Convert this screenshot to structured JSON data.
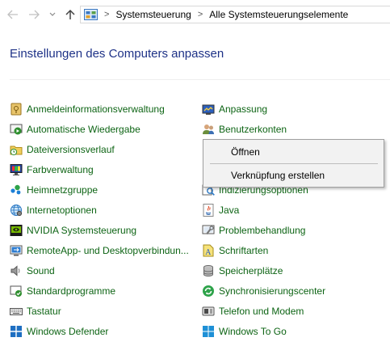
{
  "nav": {
    "breadcrumbs": [
      "Systemsteuerung",
      "Alle Systemsteuerungselemente"
    ]
  },
  "heading": "Einstellungen des Computers anpassen",
  "items_left": [
    {
      "label": "Anmeldeinformationsverwaltung",
      "icon": "credential-manager-icon"
    },
    {
      "label": "Automatische Wiedergabe",
      "icon": "autoplay-icon"
    },
    {
      "label": "Dateiversionsverlauf",
      "icon": "file-history-icon"
    },
    {
      "label": "Farbverwaltung",
      "icon": "color-management-icon"
    },
    {
      "label": "Heimnetzgruppe",
      "icon": "homegroup-icon"
    },
    {
      "label": "Internetoptionen",
      "icon": "internet-options-icon"
    },
    {
      "label": "NVIDIA Systemsteuerung",
      "icon": "nvidia-icon"
    },
    {
      "label": "RemoteApp- und Desktopverbindun...",
      "icon": "remoteapp-icon"
    },
    {
      "label": "Sound",
      "icon": "sound-icon"
    },
    {
      "label": "Standardprogramme",
      "icon": "default-programs-icon"
    },
    {
      "label": "Tastatur",
      "icon": "keyboard-icon"
    },
    {
      "label": "Windows Defender",
      "icon": "windows-defender-icon"
    }
  ],
  "items_right": [
    {
      "label": "Anpassung",
      "icon": "personalization-icon"
    },
    {
      "label": "Benutzerkonten",
      "icon": "user-accounts-icon"
    },
    {
      "label": "",
      "icon": ""
    },
    {
      "label": "",
      "icon": ""
    },
    {
      "label": "Indizierungsoptionen",
      "icon": "indexing-options-icon"
    },
    {
      "label": "Java",
      "icon": "java-icon"
    },
    {
      "label": "Problembehandlung",
      "icon": "troubleshooting-icon"
    },
    {
      "label": "Schriftarten",
      "icon": "fonts-icon"
    },
    {
      "label": "Speicherplätze",
      "icon": "storage-spaces-icon"
    },
    {
      "label": "Synchronisierungscenter",
      "icon": "sync-center-icon"
    },
    {
      "label": "Telefon und Modem",
      "icon": "phone-modem-icon"
    },
    {
      "label": "Windows To Go",
      "icon": "windows-to-go-icon"
    }
  ],
  "context_menu": {
    "open": "Öffnen",
    "create_shortcut": "Verknüpfung erstellen"
  },
  "colors": {
    "link": "#0d6414",
    "heading": "#1e3287"
  }
}
